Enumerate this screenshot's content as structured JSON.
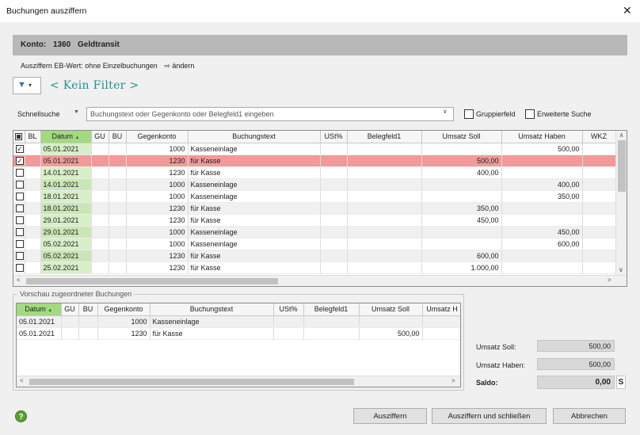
{
  "window": {
    "title": "Buchungen ausziffern",
    "close_glyph": "✕"
  },
  "konto": {
    "label": "Konto:",
    "number": "1360",
    "name": "Geldtransit"
  },
  "eb": {
    "label": "Ausziffern EB-Wert:",
    "value": "ohne Einzelbuchungen",
    "link_arrow": "⇨",
    "link": "ändern"
  },
  "filter": {
    "icon_glyph": "▼",
    "dropdown_glyph": "▾",
    "text": "< Kein Filter >"
  },
  "search": {
    "label": "Schnellsuche",
    "label_arrow": "▼",
    "placeholder": "Buchungstext oder Gegenkonto oder Belegfeld1 eingeben",
    "dropdown_glyph": "∨",
    "group_label": "Gruppierfeld",
    "ext_label": "Erweiterte Suche"
  },
  "main_table": {
    "columns": [
      "BL",
      "Datum",
      "GU",
      "BU",
      "Gegenkonto",
      "Buchungstext",
      "USt%",
      "Belegfeld1",
      "Umsatz Soll",
      "Umsatz Haben",
      "WKZ"
    ],
    "sort_glyph": "▲",
    "rows": [
      {
        "checked": true,
        "datum": "05.01.2021",
        "gegenkonto": "1000",
        "text": "Kasseneinlage",
        "soll": "",
        "haben": "500,00"
      },
      {
        "checked": true,
        "datum": "05.01.2021",
        "gegenkonto": "1230",
        "text": "für Kasse",
        "soll": "500,00",
        "haben": "",
        "selected": true
      },
      {
        "checked": false,
        "datum": "14.01.2021",
        "gegenkonto": "1230",
        "text": "für Kasse",
        "soll": "400,00",
        "haben": ""
      },
      {
        "checked": false,
        "datum": "14.01.2021",
        "gegenkonto": "1000",
        "text": "Kasseneinlage",
        "soll": "",
        "haben": "400,00"
      },
      {
        "checked": false,
        "datum": "18.01.2021",
        "gegenkonto": "1000",
        "text": "Kasseneinlage",
        "soll": "",
        "haben": "350,00"
      },
      {
        "checked": false,
        "datum": "18.01.2021",
        "gegenkonto": "1230",
        "text": "für Kasse",
        "soll": "350,00",
        "haben": ""
      },
      {
        "checked": false,
        "datum": "29.01.2021",
        "gegenkonto": "1230",
        "text": "für Kasse",
        "soll": "450,00",
        "haben": ""
      },
      {
        "checked": false,
        "datum": "29.01.2021",
        "gegenkonto": "1000",
        "text": "Kasseneinlage",
        "soll": "",
        "haben": "450,00"
      },
      {
        "checked": false,
        "datum": "05.02.2021",
        "gegenkonto": "1000",
        "text": "Kasseneinlage",
        "soll": "",
        "haben": "600,00"
      },
      {
        "checked": false,
        "datum": "05.02.2021",
        "gegenkonto": "1230",
        "text": "für Kasse",
        "soll": "600,00",
        "haben": ""
      },
      {
        "checked": false,
        "datum": "25.02.2021",
        "gegenkonto": "1230",
        "text": "für Kasse",
        "soll": "1.000,00",
        "haben": ""
      }
    ]
  },
  "preview": {
    "label": "Vorschau zugeordneter Buchungen",
    "columns": [
      "Datum",
      "GU",
      "BU",
      "Gegenkonto",
      "Buchungstext",
      "USt%",
      "Belegfeld1",
      "Umsatz Soll",
      "Umsatz H"
    ],
    "rows": [
      {
        "datum": "05.01.2021",
        "gegenkonto": "1000",
        "text": "Kasseneinlage",
        "soll": ""
      },
      {
        "datum": "05.01.2021",
        "gegenkonto": "1230",
        "text": "für Kasse",
        "soll": "500,00"
      }
    ]
  },
  "summary": {
    "soll_label": "Umsatz Soll:",
    "soll_value": "500,00",
    "haben_label": "Umsatz Haben:",
    "haben_value": "500,00",
    "saldo_label": "Saldo:",
    "saldo_value": "0,00",
    "saldo_side": "S"
  },
  "buttons": {
    "ausziffern": "Ausziffern",
    "ausziffern_schliessen": "Ausziffern und schließen",
    "abbrechen": "Abbrechen",
    "help": "?"
  },
  "scroll": {
    "left": "<",
    "right": ">",
    "up": "∧",
    "down": "∨"
  },
  "colors": {
    "selected_row": "#f29a9a",
    "sorted_header": "#a3d980",
    "date_cell": "#d8eec8",
    "filter_text": "#2a8c8c",
    "help_icon": "#5aa02c"
  }
}
